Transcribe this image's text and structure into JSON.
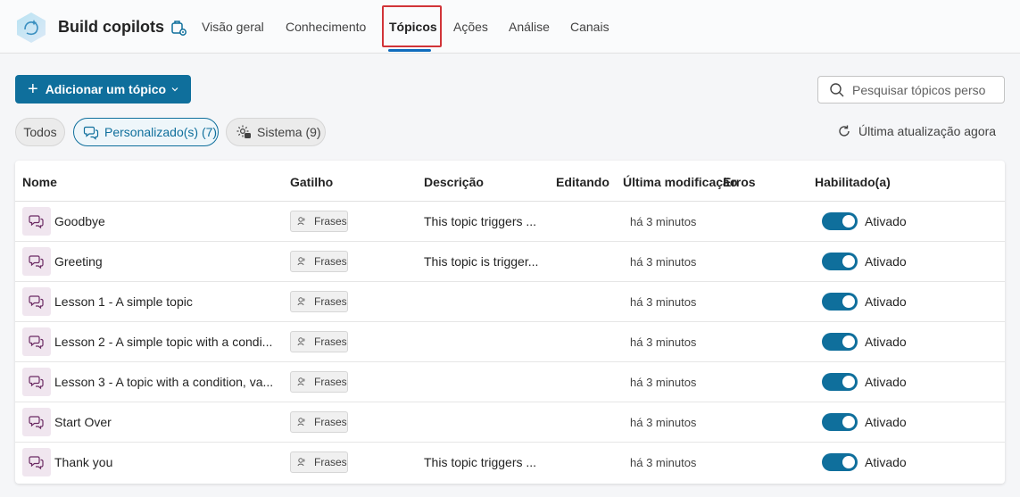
{
  "header": {
    "app_title": "Build copilots",
    "tabs": [
      {
        "label": "Visão geral"
      },
      {
        "label": "Conhecimento"
      },
      {
        "label": "Tópicos"
      },
      {
        "label": "Ações"
      },
      {
        "label": "Análise"
      },
      {
        "label": "Canais"
      }
    ],
    "active_tab": "Tópicos"
  },
  "toolbar": {
    "add_label": "Adicionar um tópico",
    "search_placeholder": "Pesquisar tópicos perso"
  },
  "filters": {
    "all": "Todos",
    "custom": "Personalizado(s) (7)",
    "system": "Sistema (9)"
  },
  "refresh_label": "Última atualização agora",
  "table": {
    "columns": {
      "name": "Nome",
      "trigger": "Gatilho",
      "description": "Descrição",
      "editing": "Editando",
      "modified": "Última modificação",
      "errors": "Erros",
      "enabled": "Habilitado(a)"
    },
    "rows": [
      {
        "name": "Goodbye",
        "trigger": "Frases",
        "description": "This topic triggers ...",
        "modified": "há 3 minutos",
        "enabled": "Ativado"
      },
      {
        "name": "Greeting",
        "trigger": "Frases",
        "description": "This topic is trigger...",
        "modified": "há 3 minutos",
        "enabled": "Ativado"
      },
      {
        "name": "Lesson 1 - A simple topic",
        "trigger": "Frases",
        "description": "",
        "modified": "há 3 minutos",
        "enabled": "Ativado"
      },
      {
        "name": "Lesson 2 - A simple topic with a condi...",
        "trigger": "Frases",
        "description": "",
        "modified": "há 3 minutos",
        "enabled": "Ativado"
      },
      {
        "name": "Lesson 3 - A topic with a condition, va...",
        "trigger": "Frases",
        "description": "",
        "modified": "há 3 minutos",
        "enabled": "Ativado"
      },
      {
        "name": "Start Over",
        "trigger": "Frases",
        "description": "",
        "modified": "há 3 minutos",
        "enabled": "Ativado"
      },
      {
        "name": "Thank you",
        "trigger": "Frases",
        "description": "This topic triggers ...",
        "modified": "há 3 minutos",
        "enabled": "Ativado"
      }
    ]
  },
  "colors": {
    "accent": "#0f6f9c",
    "active_tab_underline": "#0f6cbd",
    "highlight_box": "#d13438",
    "topic_icon_bg": "#f0e6ef"
  },
  "icons": {
    "logo": "copilot-hexagon-icon",
    "title": "copilot-settings-icon",
    "add": "plus-icon",
    "search": "search-icon",
    "custom": "chat-bubbles-icon",
    "system": "gear-chat-icon",
    "refresh": "refresh-icon",
    "topic": "chat-bubbles-icon",
    "trigger": "phrases-icon"
  }
}
